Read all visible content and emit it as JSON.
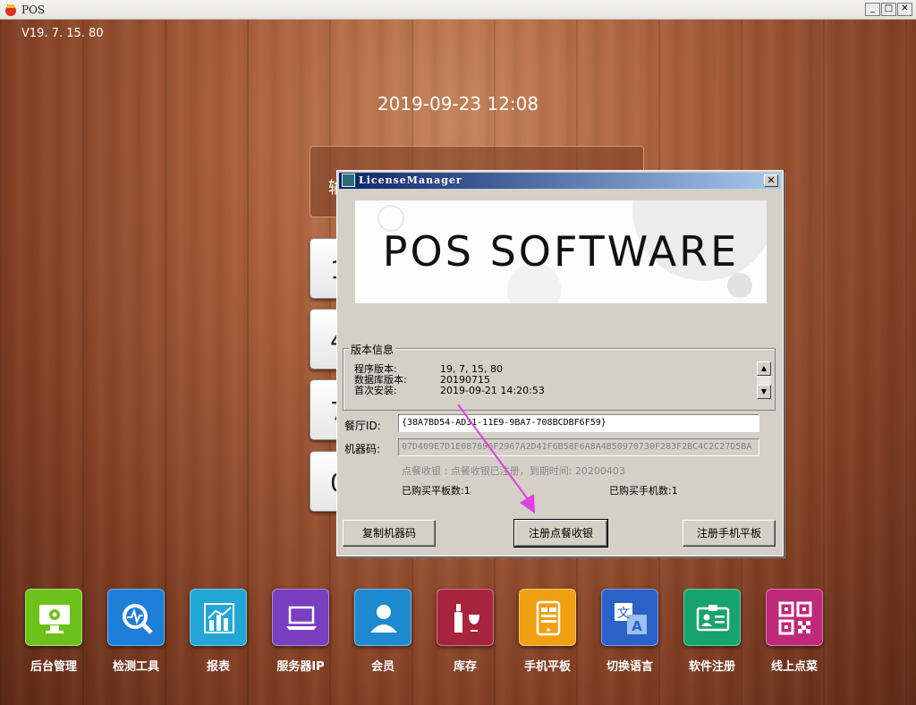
{
  "window": {
    "title": "POS",
    "btn_min": "_",
    "btn_max": "□",
    "btn_close": "✕"
  },
  "desktop": {
    "version": "V19. 7. 15. 80",
    "clock": "2019-09-23 12:08",
    "login_label": "输",
    "keypad": [
      "1",
      "4",
      "7",
      "0"
    ]
  },
  "dock": [
    {
      "label": "后台管理",
      "icon": "monitor-gear-icon",
      "color": "#6cc21a"
    },
    {
      "label": "检测工具",
      "icon": "magnifier-pulse-icon",
      "color": "#1e7fd8"
    },
    {
      "label": "报表",
      "icon": "bar-chart-icon",
      "color": "#22a6d6"
    },
    {
      "label": "服务器IP",
      "icon": "laptop-icon",
      "color": "#7a3fc0"
    },
    {
      "label": "会员",
      "icon": "person-icon",
      "color": "#1d8ad0"
    },
    {
      "label": "库存",
      "icon": "wine-icon",
      "color": "#a8243e"
    },
    {
      "label": "手机平板",
      "icon": "tablet-icon",
      "color": "#f0a010"
    },
    {
      "label": "切换语言",
      "icon": "translate-icon",
      "color": "#2a62c8"
    },
    {
      "label": "软件注册",
      "icon": "id-card-icon",
      "color": "#17a36d"
    },
    {
      "label": "线上点菜",
      "icon": "qr-code-icon",
      "color": "#c0287a"
    }
  ],
  "dialog": {
    "title": "LicenseManager",
    "close": "✕",
    "banner_text": "POS SOFTWARE",
    "version_group": "版本信息",
    "version_rows": [
      {
        "k": "程序版本:",
        "v": "19, 7, 15, 80"
      },
      {
        "k": "数据库版本:",
        "v": "20190715"
      },
      {
        "k": "首次安装:",
        "v": "2019-09-21 14:20:53"
      }
    ],
    "restaurant_id_label": "餐厅ID:",
    "restaurant_id": "{38A7BD54-AD31-11E9-9BA7-708BCDBF6F59}",
    "machine_code_label": "机器码:",
    "machine_code": "07D409E7D1E087696F2967A2D41F6B58F6A8A4B50970730F283F2BC4C2C27D5BA",
    "status_line": "点餐收银 : 点餐收银已注册，到期时间: 20200403",
    "tablets_bought": "已购买平板数:1",
    "phones_bought": "已购买手机数:1",
    "btn_copy": "复制机器码",
    "btn_register_pos": "注册点餐收银",
    "btn_register_mobile": "注册手机平板"
  },
  "colors": {
    "arrow": "#e040e0",
    "titlebar": "#0a246a"
  }
}
